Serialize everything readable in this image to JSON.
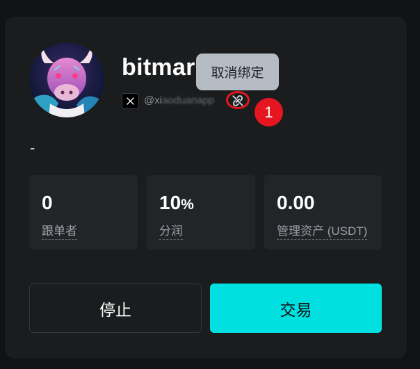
{
  "profile": {
    "name": "bitmar",
    "handle_visible": "@xi",
    "handle_blurred": "aoduanapp",
    "social_icon": "x-logo-icon",
    "bio": "-"
  },
  "tooltip": {
    "text": "取消绑定"
  },
  "marker": {
    "label": "1"
  },
  "stats": [
    {
      "value": "0",
      "suffix": "",
      "label": "跟单者"
    },
    {
      "value": "10",
      "suffix": "%",
      "label": "分润"
    },
    {
      "value": "0.00",
      "suffix": "",
      "label": "管理资产 (USDT)"
    }
  ],
  "buttons": {
    "stop": "停止",
    "trade": "交易"
  },
  "colors": {
    "accent": "#00e0e0",
    "card_bg": "#1a1c1e",
    "stat_bg": "#222528",
    "highlight": "#e5161f",
    "tooltip_bg": "#b5bcc3"
  }
}
